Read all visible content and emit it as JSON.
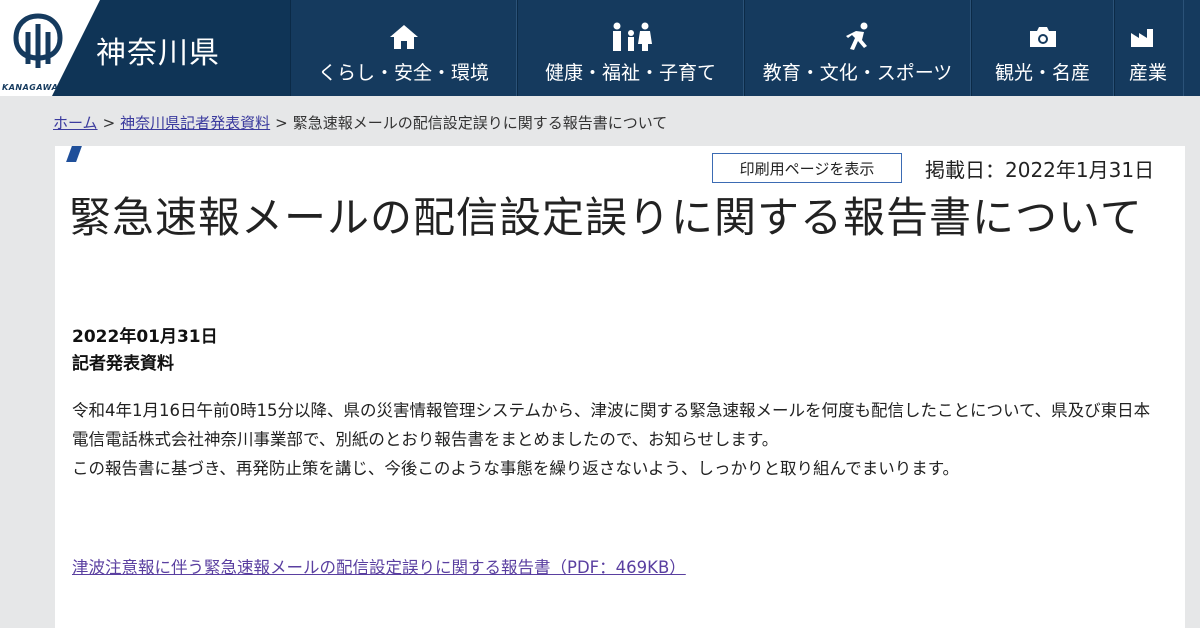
{
  "header": {
    "pref_name": "神奈川県",
    "logo_caption": "KANAGAWA"
  },
  "nav": {
    "items": [
      {
        "label": "くらし・安全・環境",
        "icon": "house-icon"
      },
      {
        "label": "健康・福祉・子育て",
        "icon": "family-icon"
      },
      {
        "label": "教育・文化・スポーツ",
        "icon": "runner-icon"
      },
      {
        "label": "観光・名産",
        "icon": "camera-icon"
      },
      {
        "label": "産業",
        "icon": "industry-icon"
      }
    ]
  },
  "breadcrumb": {
    "home": "ホーム",
    "sep": ">",
    "parent": "神奈川県記者発表資料",
    "current": "緊急速報メールの配信設定誤りに関する報告書について"
  },
  "page": {
    "print_label": "印刷用ページを表示",
    "published": "掲載日：2022年1月31日",
    "title": "緊急速報メールの配信設定誤りに関する報告書について",
    "date": "2022年01月31日",
    "type": "記者発表資料",
    "body": [
      "令和4年1月16日午前0時15分以降、県の災害情報管理システムから、津波に関する緊急速報メールを何度も配信したことについて、県及び東日本電信電話株式会社神奈川事業部で、別紙のとおり報告書をまとめましたので、お知らせします。",
      "この報告書に基づき、再発防止策を講じ、今後このような事態を繰り返さないよう、しっかりと取り組んでまいります。"
    ],
    "pdf_link": "津波注意報に伴う緊急速報メールの配信設定誤りに関する報告書（PDF：469KB）"
  },
  "colors": {
    "header_bg": "#153a5e",
    "link": "#3b3b9e",
    "visited_link": "#5a3fa0",
    "accent": "#1f4f9a"
  }
}
